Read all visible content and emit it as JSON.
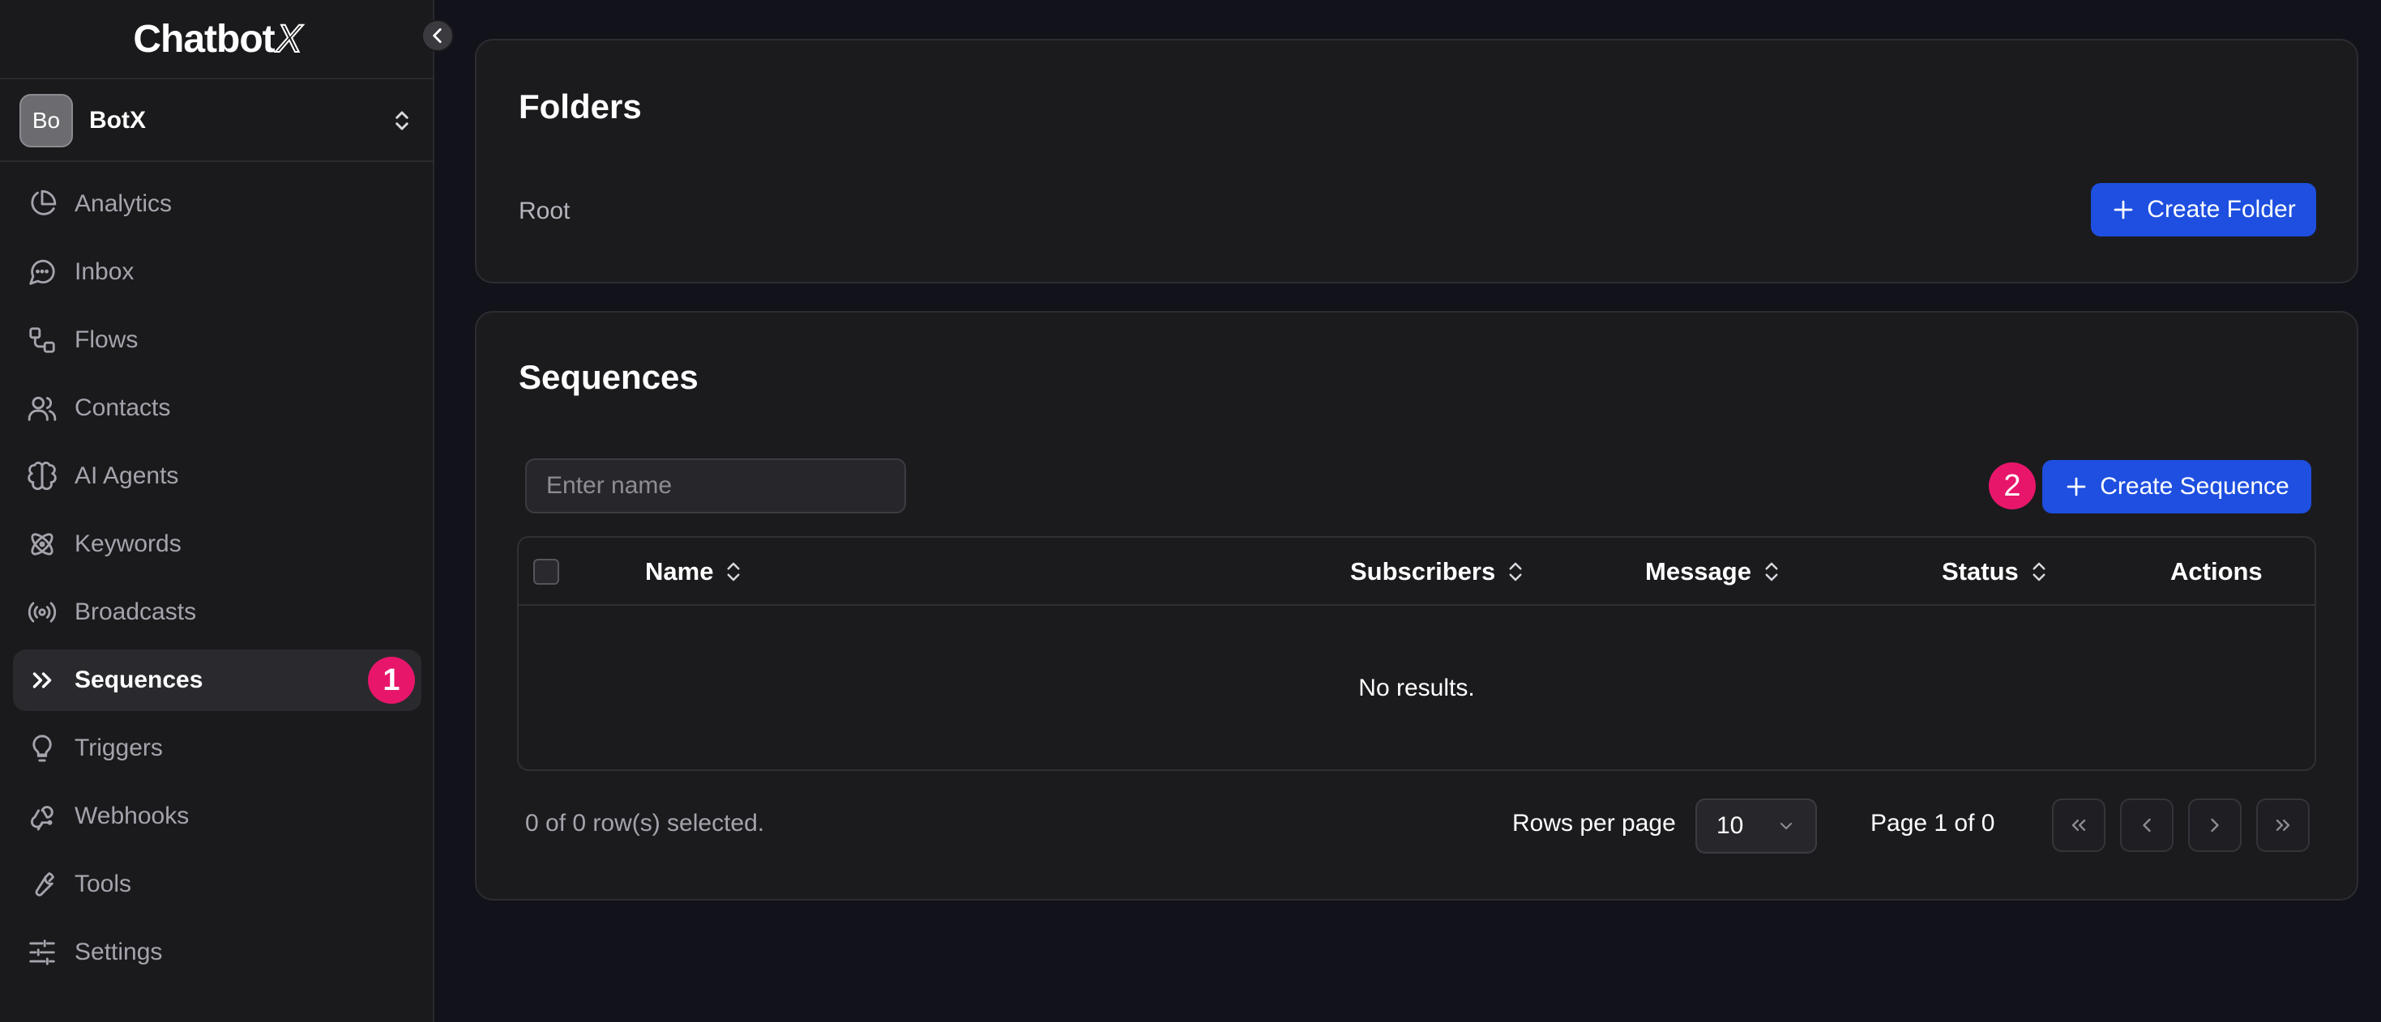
{
  "app": {
    "logo_text": "Chatbot",
    "logo_mark": "X"
  },
  "workspace": {
    "avatar_initials": "Bo",
    "name": "BotX"
  },
  "sidebar": {
    "items": [
      {
        "label": "Analytics",
        "icon": "pie-chart-icon"
      },
      {
        "label": "Inbox",
        "icon": "message-circle-icon"
      },
      {
        "label": "Flows",
        "icon": "flow-icon"
      },
      {
        "label": "Contacts",
        "icon": "users-icon"
      },
      {
        "label": "AI Agents",
        "icon": "brain-icon"
      },
      {
        "label": "Keywords",
        "icon": "atom-icon"
      },
      {
        "label": "Broadcasts",
        "icon": "broadcast-icon"
      },
      {
        "label": "Sequences",
        "icon": "chevrons-right-icon",
        "active": true,
        "badge": "1"
      },
      {
        "label": "Triggers",
        "icon": "lightbulb-icon"
      },
      {
        "label": "Webhooks",
        "icon": "webhook-icon"
      },
      {
        "label": "Tools",
        "icon": "wrench-icon"
      },
      {
        "label": "Settings",
        "icon": "sliders-icon"
      }
    ]
  },
  "folders": {
    "title": "Folders",
    "breadcrumb": "Root",
    "create_label": "Create Folder"
  },
  "sequences": {
    "title": "Sequences",
    "search_placeholder": "Enter name",
    "create_label": "Create Sequence",
    "create_badge": "2",
    "columns": {
      "name": "Name",
      "subscribers": "Subscribers",
      "message": "Message",
      "status": "Status",
      "actions": "Actions"
    },
    "empty_text": "No results.",
    "selected_text": "0 of 0 row(s) selected.",
    "rows_per_page_label": "Rows per page",
    "rows_per_page_value": "10",
    "page_info": "Page 1 of 0"
  },
  "colors": {
    "accent": "#1e4fe0",
    "badge": "#e8166b",
    "background": "#12121a",
    "card": "#1b1b1e"
  }
}
